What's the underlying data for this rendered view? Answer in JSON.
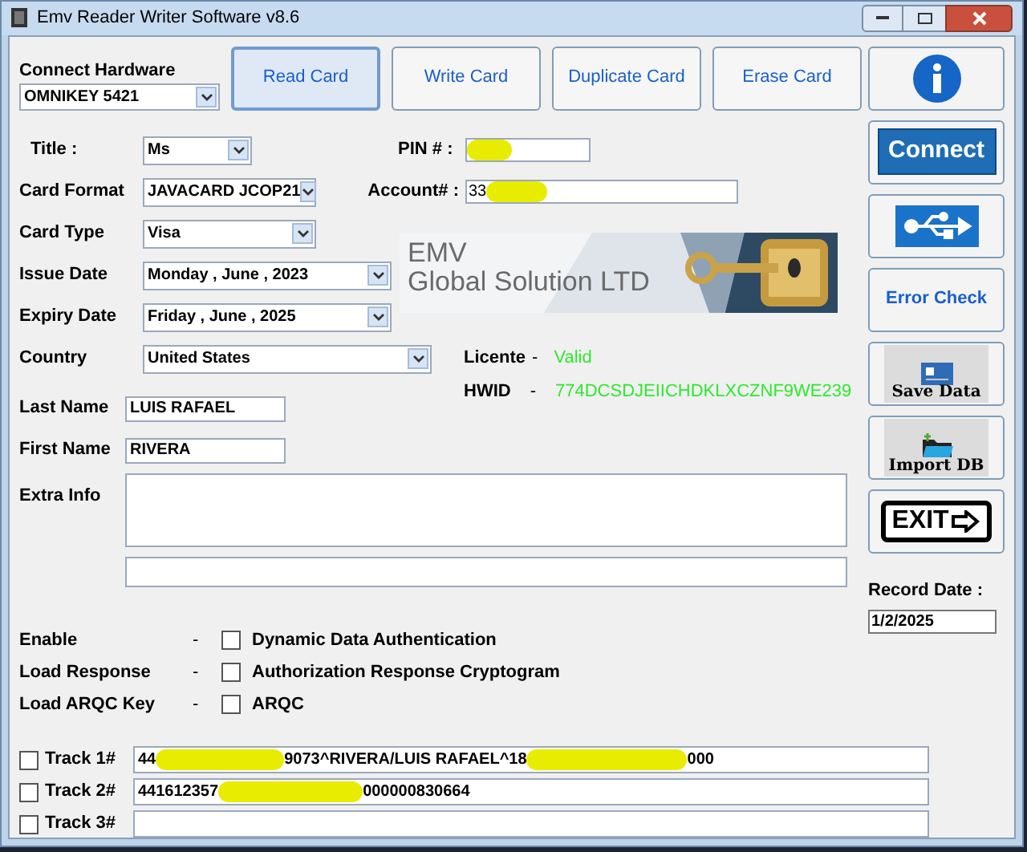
{
  "window": {
    "title": "Emv Reader Writer Software v8.6"
  },
  "hardware": {
    "label": "Connect Hardware",
    "value": "OMNIKEY 5421"
  },
  "top_buttons": [
    {
      "label": "Read Card",
      "selected": true
    },
    {
      "label": "Write Card",
      "selected": false
    },
    {
      "label": "Duplicate Card",
      "selected": false
    },
    {
      "label": "Erase Card",
      "selected": false
    }
  ],
  "form": [
    {
      "label": "Title :",
      "value": "Ms",
      "kind": "dropdown"
    },
    {
      "label": "Card Format",
      "value": "JAVACARD JCOP21",
      "kind": "dropdown"
    },
    {
      "label": "Card Type",
      "value": "Visa",
      "kind": "dropdown"
    },
    {
      "label": "Issue Date",
      "value": "Monday , June , 2023",
      "kind": "dropdown"
    },
    {
      "label": "Expiry Date",
      "value": "Friday , June , 2025",
      "kind": "dropdown"
    },
    {
      "label": "Country",
      "value": "United States",
      "kind": "dropdown"
    },
    {
      "label": "Last Name",
      "value": "LUIS RAFAEL",
      "kind": "text"
    },
    {
      "label": "First Name",
      "value": "RIVERA",
      "kind": "text"
    }
  ],
  "pin": {
    "label": "PIN # :",
    "redacted": true
  },
  "account": {
    "label": "Account# :",
    "value": "33",
    "redacted": true
  },
  "banner": {
    "line1": "EMV",
    "line2": "Global Solution LTD"
  },
  "license": {
    "label": "Licente",
    "dash": "-",
    "value": "Valid"
  },
  "hwid": {
    "label": "HWID",
    "dash": "-",
    "value": "774DCSDJEIICHDKLXCZNF9WE239"
  },
  "extra_info": {
    "label": "Extra Info"
  },
  "side_buttons": [
    {
      "kind": "info"
    },
    {
      "kind": "connect",
      "label": "Connect"
    },
    {
      "kind": "usb"
    },
    {
      "kind": "text",
      "label": "Error Check"
    },
    {
      "kind": "save",
      "label": "Save Data"
    },
    {
      "kind": "import",
      "label": "Import DB"
    },
    {
      "kind": "exit",
      "label": "EXIT"
    }
  ],
  "record_date": {
    "label": "Record Date :",
    "value": "1/2/2025"
  },
  "options": [
    {
      "label": "Enable",
      "dash": "-",
      "text": "Dynamic Data Authentication",
      "checked": false
    },
    {
      "label": "Load Response",
      "dash": "-",
      "text": "Authorization Response Cryptogram",
      "checked": false
    },
    {
      "label": "Load ARQC Key",
      "dash": "-",
      "text": "ARQC",
      "checked": false
    }
  ],
  "tracks": [
    {
      "label": "Track 1#",
      "checked": false,
      "segments": [
        "44",
        "9073^RIVERA/LUIS RAFAEL^18",
        "000"
      ]
    },
    {
      "label": "Track 2#",
      "checked": false,
      "segments": [
        "441612357",
        "000000830664"
      ]
    },
    {
      "label": "Track 3#",
      "checked": false
    }
  ]
}
